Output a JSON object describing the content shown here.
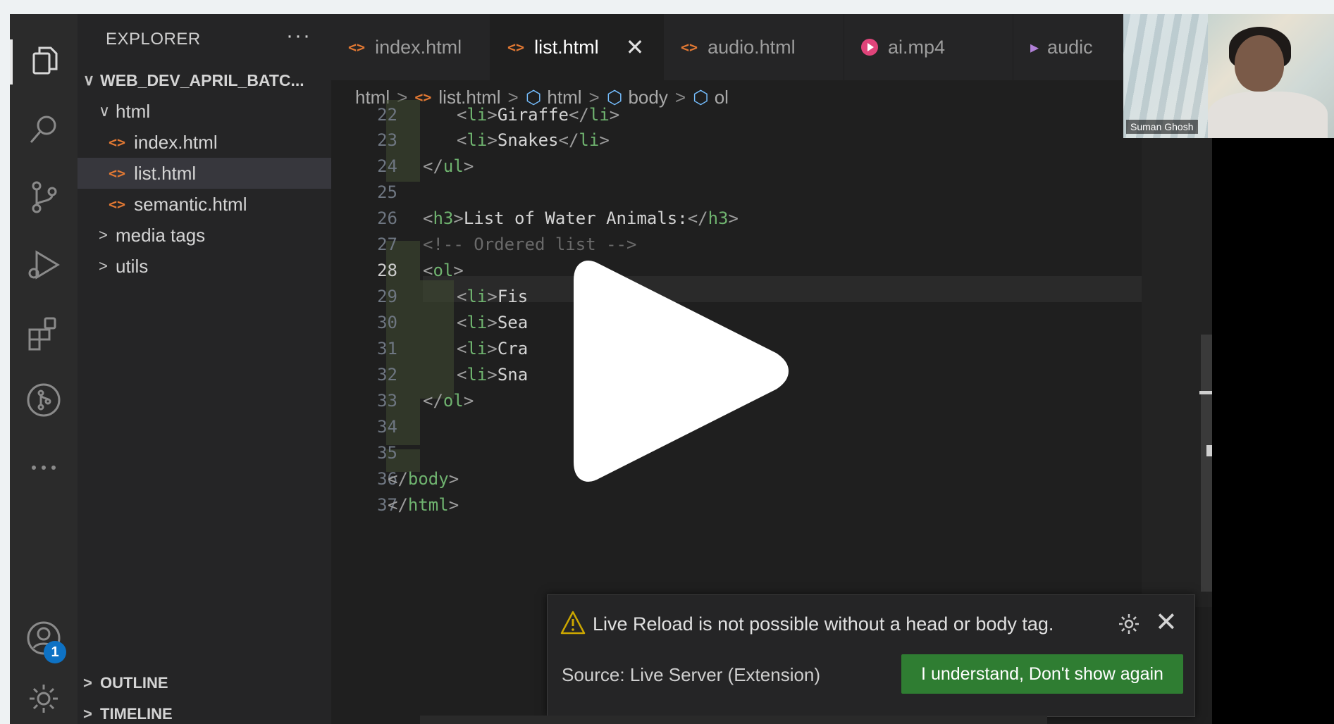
{
  "sidebar": {
    "title": "EXPLORER",
    "more": "···",
    "root": "WEB_DEV_APRIL_BATC...",
    "tree": [
      {
        "label": "html",
        "chevron": "∨"
      },
      {
        "label": "index.html",
        "icon": "<>"
      },
      {
        "label": "list.html",
        "icon": "<>"
      },
      {
        "label": "semantic.html",
        "icon": "<>"
      },
      {
        "label": "media tags",
        "chevron": ">"
      },
      {
        "label": "utils",
        "chevron": ">"
      }
    ],
    "outline": "OUTLINE",
    "timeline": "TIMELINE",
    "account_badge": "1"
  },
  "tabs": [
    {
      "label": "index.html",
      "icon": "<>"
    },
    {
      "label": "list.html",
      "icon": "<>",
      "close": "✕"
    },
    {
      "label": "audio.html",
      "icon": "<>"
    },
    {
      "label": "ai.mp4"
    },
    {
      "label": "audic"
    }
  ],
  "breadcrumb": [
    "html",
    "list.html",
    "html",
    "body",
    "ol"
  ],
  "editor": {
    "lines": [
      {
        "n": "22",
        "code": "<li>Giraffe</li>"
      },
      {
        "n": "23",
        "code": "<li>Snakes</li>"
      },
      {
        "n": "24",
        "code": "</ul>"
      },
      {
        "n": "25",
        "code": ""
      },
      {
        "n": "26",
        "code": "<h3>List of Water Animals:</h3>"
      },
      {
        "n": "27",
        "code": "<!-- Ordered list -->"
      },
      {
        "n": "28",
        "code": "<ol>"
      },
      {
        "n": "29",
        "code": "<li>Fis"
      },
      {
        "n": "30",
        "code": "<li>Sea"
      },
      {
        "n": "31",
        "code": "<li>Cra"
      },
      {
        "n": "32",
        "code": "<li>Sna"
      },
      {
        "n": "33",
        "code": "</ol>"
      },
      {
        "n": "34",
        "code": ""
      },
      {
        "n": "35",
        "code": ""
      },
      {
        "n": "36",
        "code": "</body>"
      },
      {
        "n": "37",
        "code": "</html>"
      }
    ]
  },
  "webcam": {
    "name": "Suman Ghosh"
  },
  "notification": {
    "message": "Live Reload is not possible without a head or body tag.",
    "source": "Source: Live Server (Extension)",
    "button": "I understand, Don't show again",
    "close": "✕"
  },
  "colors": {
    "accent_button": "#2f7d32",
    "tag_green": "#6fb36f",
    "file_icon_orange": "#e37933",
    "badge_blue": "#0e72c4"
  }
}
